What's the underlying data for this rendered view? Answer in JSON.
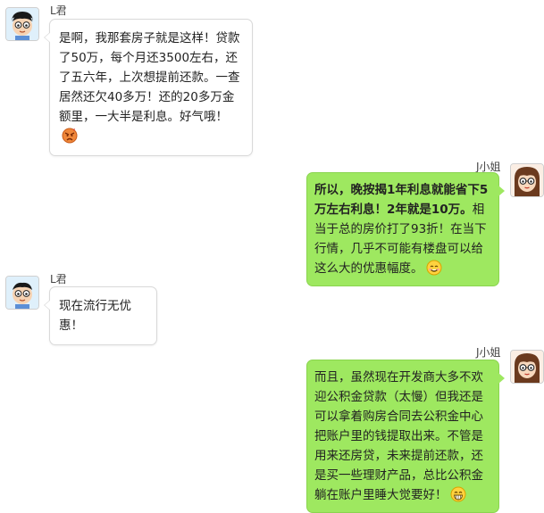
{
  "messages": [
    {
      "sender": "L君",
      "side": "left",
      "avatar_icon": "boy-avatar-icon",
      "text": "是啊，我那套房子就是这样！贷款了50万，每个月还3500左右，还了五六年，上次想提前还款。一查居然还欠40多万！还的20多万金额里，一大半是利息。好气哦！",
      "emoji": "angry-face-icon"
    },
    {
      "sender": "J小姐",
      "side": "right",
      "avatar_icon": "girl-avatar-icon",
      "text_bold": "所以，晚按揭1年利息就能省下5万左右利息！2年就是10万。",
      "text": "相当于总的房价打了93折！在当下行情，几乎不可能有楼盘可以给这么大的优惠幅度。",
      "emoji": "smile-face-icon"
    },
    {
      "sender": "L君",
      "side": "left",
      "avatar_icon": "boy-avatar-icon",
      "text": "现在流行无优惠！"
    },
    {
      "sender": "J小姐",
      "side": "right",
      "avatar_icon": "girl-avatar-icon",
      "text": "而且，虽然现在开发商大多不欢迎公积金贷款（太慢）但我还是可以拿着购房合同去公积金中心把账户里的钱提取出来。不管是用来还房贷，未来提前还款，还是买一些理财产品，总比公积金躺在账户里睡大觉要好！",
      "emoji": "grin-face-icon"
    }
  ],
  "colors": {
    "left_bubble": "#ffffff",
    "right_bubble": "#9ee860",
    "bubble_border": "#d9d9d9"
  }
}
